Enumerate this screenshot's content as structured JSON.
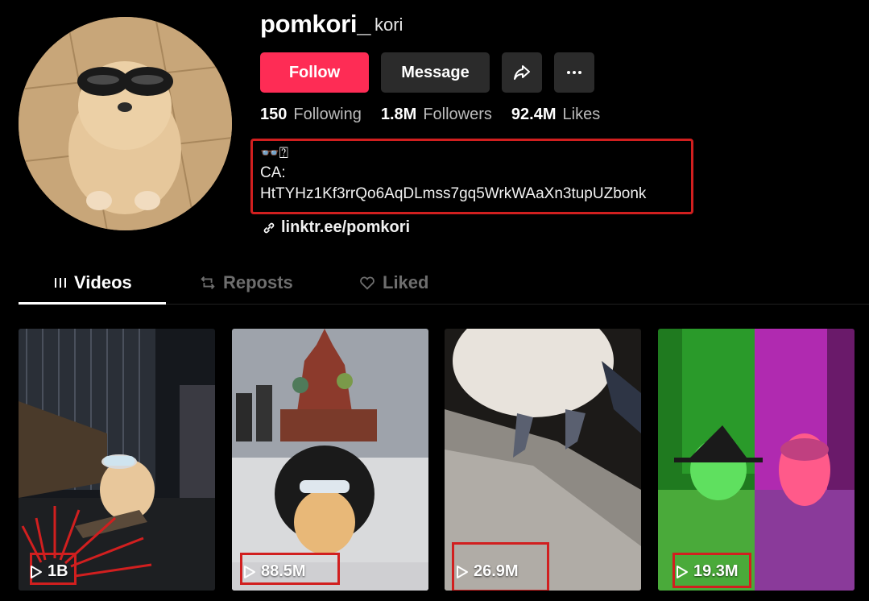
{
  "profile": {
    "username": "pomkori_",
    "nickname": "kori",
    "avatar_icon": "pomeranian-sunglasses-avatar"
  },
  "actions": {
    "follow_label": "Follow",
    "message_label": "Message",
    "share_icon": "share-arrow-icon",
    "more_icon": "more-dots-icon"
  },
  "stats": {
    "following_count": "150",
    "following_label": "Following",
    "followers_count": "1.8M",
    "followers_label": "Followers",
    "likes_count": "92.4M",
    "likes_label": "Likes"
  },
  "bio": {
    "line1": "👓⍰",
    "line2": "CA:",
    "line3": "HtTYHz1Kf3rrQo6AqDLmss7gq5WrkWAaXn3tupUZbonk"
  },
  "link": {
    "text": "linktr.ee/pomkori",
    "icon": "link-icon"
  },
  "tabs": {
    "videos": "Videos",
    "reposts": "Reposts",
    "liked": "Liked"
  },
  "videos": [
    {
      "views": "1B"
    },
    {
      "views": "88.5M"
    },
    {
      "views": "26.9M"
    },
    {
      "views": "19.3M"
    }
  ],
  "colors": {
    "accent": "#fe2c55",
    "annotation": "#d11f1f",
    "button_bg": "#2b2b2b",
    "background": "#000000"
  }
}
